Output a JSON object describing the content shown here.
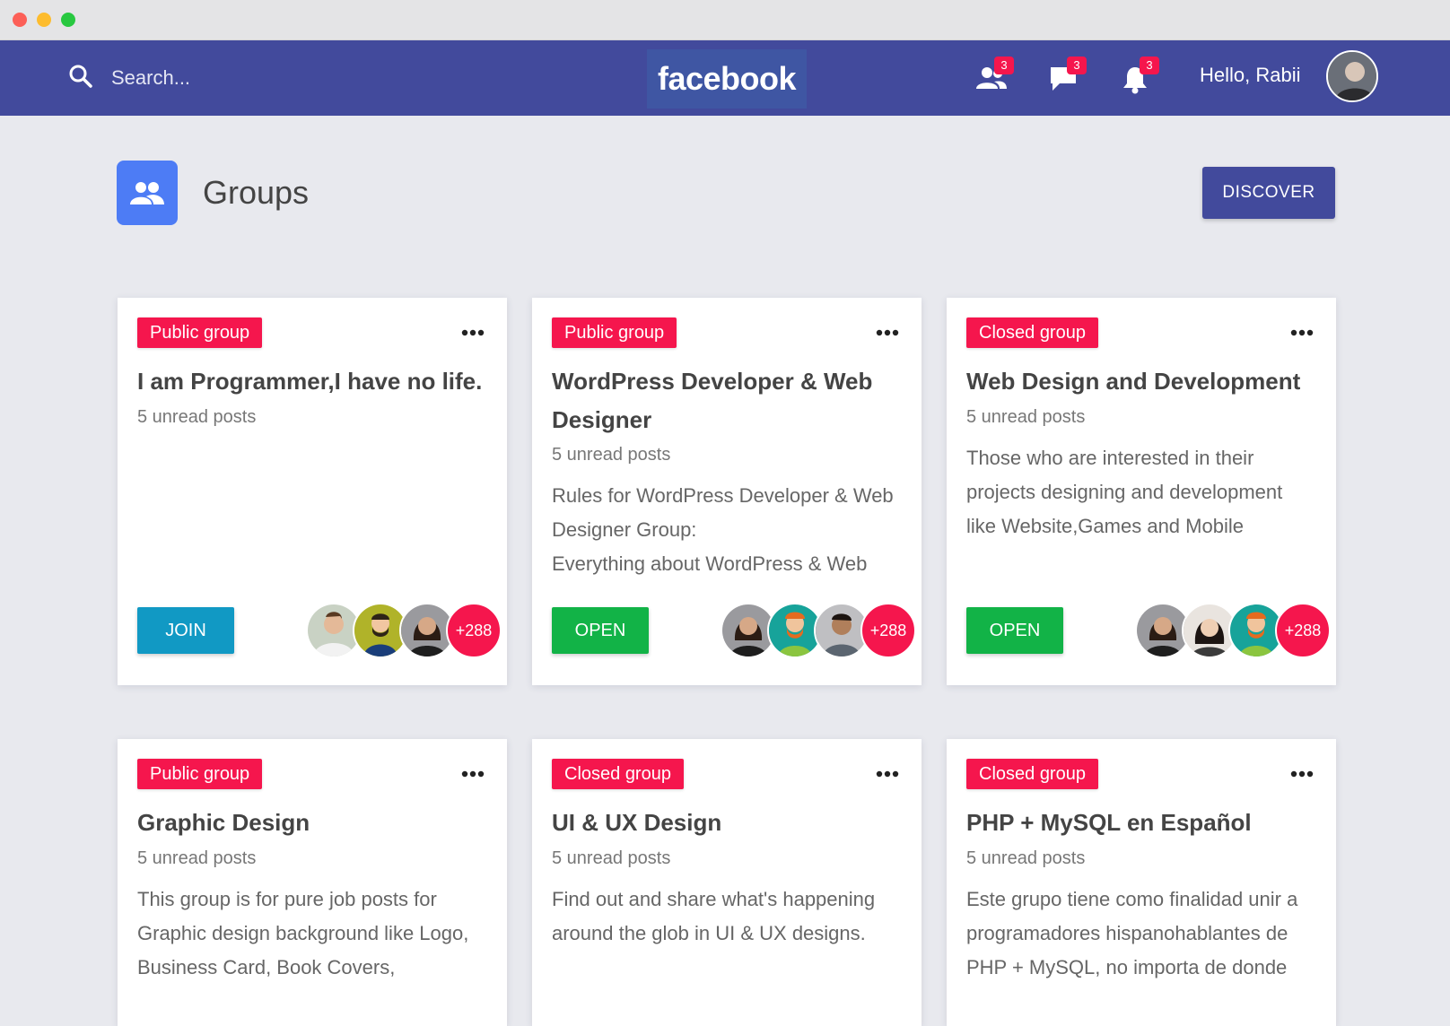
{
  "navbar": {
    "search_placeholder": "Search...",
    "brand": "facebook",
    "friends_count": "3",
    "messages_count": "3",
    "notifications_count": "3",
    "greeting": "Hello, Rabii"
  },
  "page": {
    "title": "Groups",
    "discover_label": "DISCOVER"
  },
  "cards": [
    {
      "badge": "Public group",
      "title": "I am Programmer,I have no life.",
      "unread": "5 unread posts",
      "description": [],
      "action": "JOIN",
      "member_count": "+288"
    },
    {
      "badge": "Public group",
      "title": "WordPress Developer & Web Designer",
      "unread": "5 unread posts",
      "description": [
        "Rules for WordPress Developer & Web",
        "Designer Group:",
        "Everything about WordPress & Web"
      ],
      "action": "OPEN",
      "member_count": "+288"
    },
    {
      "badge": "Closed group",
      "title": "Web Design and Development",
      "unread": "5 unread posts",
      "description": [
        "Those who are interested in their",
        "projects designing and development",
        "like Website,Games and Mobile"
      ],
      "action": "OPEN",
      "member_count": "+288"
    },
    {
      "badge": "Public group",
      "title": "Graphic Design",
      "unread": "5 unread posts",
      "description": [
        "This group is for pure job posts for",
        "Graphic design background like Logo,",
        "Business Card, Book Covers,"
      ]
    },
    {
      "badge": "Closed group",
      "title": "UI & UX Design",
      "unread": "5 unread posts",
      "description": [
        "Find out and share what's happening",
        "around the glob in UI & UX designs."
      ]
    },
    {
      "badge": "Closed group",
      "title": "PHP + MySQL en Español",
      "unread": "5 unread posts",
      "description": [
        "Este grupo tiene como finalidad unir a",
        "programadores hispanohablantes de",
        "PHP + MySQL, no importa de donde"
      ]
    }
  ],
  "colors": {
    "navbar": "#424a9c",
    "badge": "#f5164d",
    "join": "#1199c4",
    "open": "#12b347",
    "groups_icon": "#4d7cf5"
  }
}
